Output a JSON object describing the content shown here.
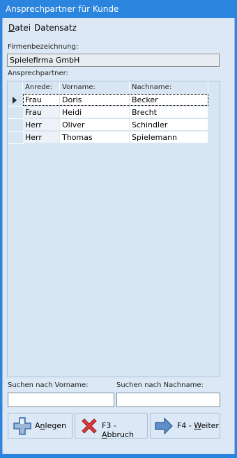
{
  "window": {
    "title": "Ansprechpartner für Kunde"
  },
  "menu": [
    "Datei",
    "Datensatz"
  ],
  "firm": {
    "label": "Firmenbezeichnung:",
    "value": "Spielefirma GmbH"
  },
  "contacts": {
    "label": "Ansprechpartner:",
    "columns": [
      "Anrede:",
      "Vorname:",
      "Nachname:"
    ],
    "rows": [
      [
        "Frau",
        "Doris",
        "Becker"
      ],
      [
        "Frau",
        "Heidi",
        "Brecht"
      ],
      [
        "Herr",
        "Oliver",
        "Schindler"
      ],
      [
        "Herr",
        "Thomas",
        "Spielemann"
      ]
    ],
    "selected_row": 0
  },
  "search": {
    "firstname_label": "Suchen nach Vorname:",
    "lastname_label": "Suchen nach Nachname:",
    "firstname_value": "",
    "lastname_value": ""
  },
  "buttons": {
    "add": {
      "pre": "A",
      "accel": "n",
      "post": "legen",
      "icon": "plus-icon"
    },
    "cancel": {
      "pre": "F3 - ",
      "accel": "A",
      "post": "bbruch",
      "icon": "red-x-icon"
    },
    "next": {
      "pre": "F4 - ",
      "accel": "W",
      "post": "eiter",
      "icon": "blue-arrow-right-icon"
    }
  },
  "colors": {
    "titlebar": "#2b84dd",
    "window_bg": "#dce8f5"
  }
}
